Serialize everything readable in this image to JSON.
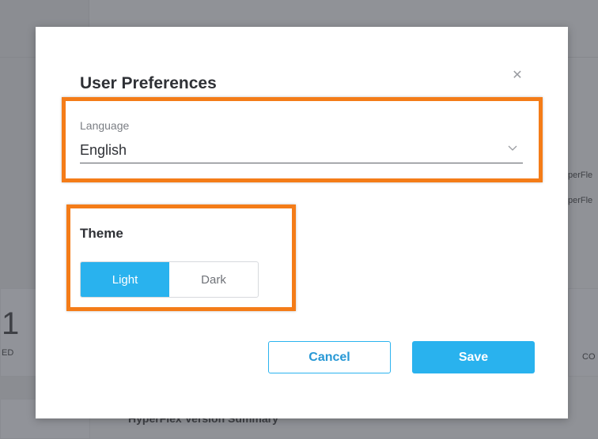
{
  "background": {
    "fragments": [
      "perFle",
      "perFle",
      "1",
      "ED",
      "CO",
      "HyperFlex Version Summary"
    ]
  },
  "dialog": {
    "title": "User Preferences",
    "close_icon": "close-icon",
    "language": {
      "label": "Language",
      "value": "English",
      "chevron_icon": "chevron-down-icon"
    },
    "theme": {
      "label": "Theme",
      "options": [
        "Light",
        "Dark"
      ],
      "selected": "Light"
    },
    "buttons": {
      "cancel": "Cancel",
      "save": "Save"
    }
  },
  "colors": {
    "accent": "#29b2ee",
    "highlight": "#f47c18",
    "overlay": "#909297"
  }
}
